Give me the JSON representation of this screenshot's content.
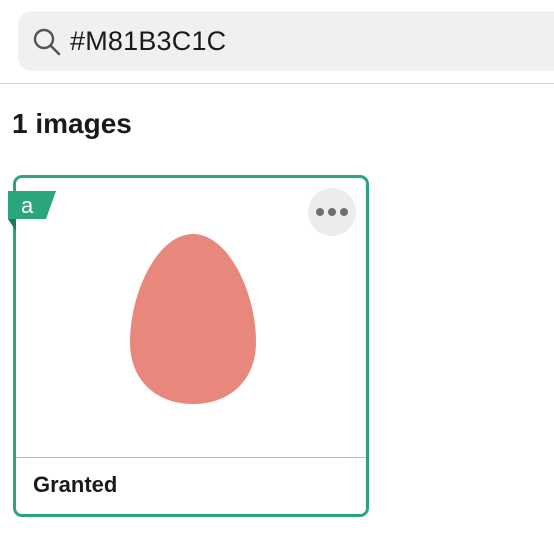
{
  "search": {
    "value": "#M81B3C1C",
    "icon": "search-icon"
  },
  "results": {
    "count_label": "1 images"
  },
  "card": {
    "status_label": "Granted",
    "badge_icon": "a-badge-icon",
    "menu_icon": "more-horizontal-icon",
    "accent_color": "#2aa67a",
    "shape_color": "#e8877c"
  }
}
